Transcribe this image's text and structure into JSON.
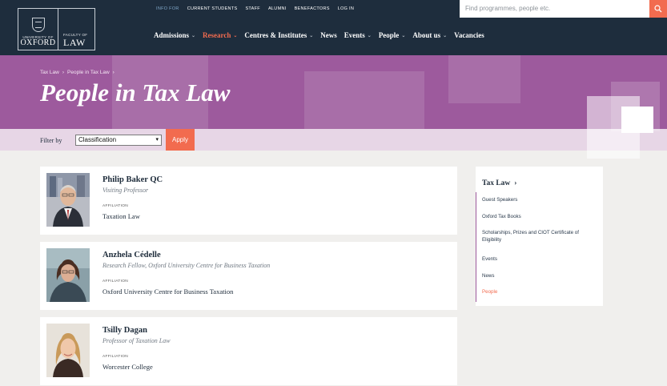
{
  "logo": {
    "uni_small": "UNIVERSITY OF",
    "uni_big": "OXFORD",
    "fac_small": "FACULTY OF",
    "fac_big": "LAW"
  },
  "utility": [
    "INFO FOR",
    "CURRENT STUDENTS",
    "STAFF",
    "ALUMNI",
    "BENEFACTORS",
    "LOG IN"
  ],
  "search": {
    "placeholder": "Find programmes, people etc."
  },
  "nav": [
    {
      "label": "Admissions",
      "chev": true
    },
    {
      "label": "Research",
      "chev": true,
      "active": true
    },
    {
      "label": "Centres & Institutes",
      "chev": true
    },
    {
      "label": "News",
      "chev": false
    },
    {
      "label": "Events",
      "chev": true
    },
    {
      "label": "People",
      "chev": true
    },
    {
      "label": "About us",
      "chev": true
    },
    {
      "label": "Vacancies",
      "chev": false
    }
  ],
  "breadcrumb": [
    "Tax Law",
    "People in Tax Law"
  ],
  "page_title": "People in Tax Law",
  "filter": {
    "label": "Filter by",
    "selected": "Classification",
    "apply": "Apply"
  },
  "people": [
    {
      "name": "Philip Baker QC",
      "role": "Visiting Professor",
      "aff_label": "AFFILIATION",
      "affiliation": "Taxation Law"
    },
    {
      "name": "Anzhela Cédelle",
      "role": "Research Fellow, Oxford University Centre for Business Taxation",
      "aff_label": "AFFILIATION",
      "affiliation": "Oxford University Centre for Business Taxation"
    },
    {
      "name": "Tsilly Dagan",
      "role": "Professor of Taxation Law",
      "aff_label": "AFFILIATION",
      "affiliation": "Worcester College"
    }
  ],
  "sidebar": {
    "title": "Tax Law",
    "items": [
      "Guest Speakers",
      "Oxford Tax Books",
      "Scholarships, Prizes and CIOT Certificate of Eligibility",
      "Events",
      "News",
      "People"
    ]
  },
  "colors": {
    "navy": "#1e2d3d",
    "purple": "#9d5a9d",
    "accent": "#f26b4f"
  }
}
